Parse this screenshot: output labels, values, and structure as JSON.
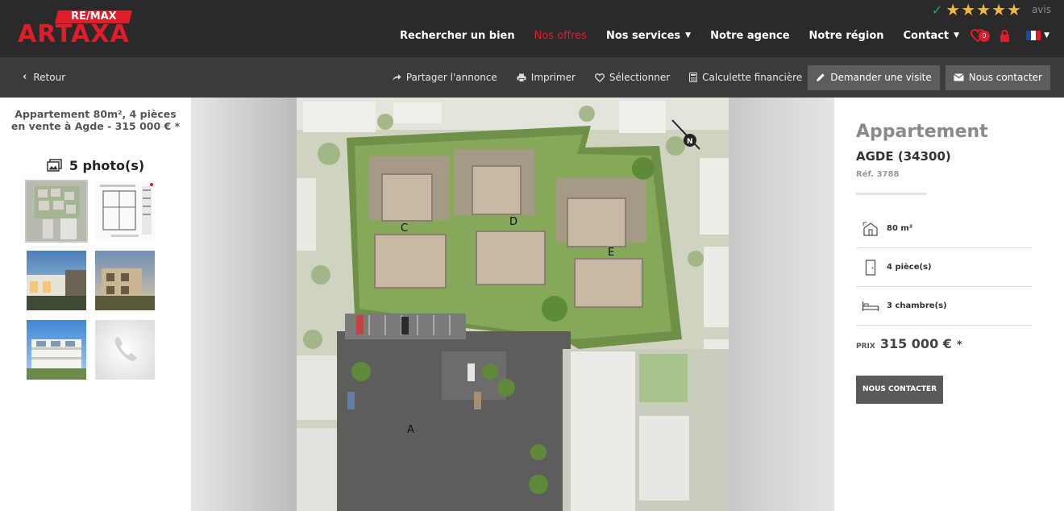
{
  "header": {
    "logo_top": "RE/MAX",
    "logo_brand": "ARTAXA",
    "rating_stars": "★★★★★",
    "rating_label": "avis",
    "nav": [
      {
        "label": "Rechercher un bien"
      },
      {
        "label": "Nos offres",
        "active": true
      },
      {
        "label": "Nos services"
      },
      {
        "label": "Notre agence"
      },
      {
        "label": "Notre région"
      },
      {
        "label": "Contact"
      }
    ],
    "favorites_count": "0"
  },
  "subbar": {
    "back_label": "Retour",
    "actions": {
      "share": "Partager l'annonce",
      "print": "Imprimer",
      "select": "Sélectionner",
      "calc": "Calculette financière",
      "visit": "Demander une visite",
      "contact": "Nous contacter"
    }
  },
  "left": {
    "title": "Appartement 80m², 4 pièces en vente à Agde - 315 000 € *",
    "photo_count": "5 photo(s)"
  },
  "property": {
    "type": "Appartement",
    "city": "AGDE (34300)",
    "ref": "Réf. 3788",
    "features": {
      "surface": "80 m²",
      "rooms": "4 pièce(s)",
      "bedrooms": "3 chambre(s)"
    },
    "price_label": "PRIX",
    "price": "315 000 €",
    "price_star": "*",
    "contact_button": "NOUS CONTACTER"
  },
  "plan": {
    "labels": {
      "a": "A",
      "c": "C",
      "d": "D",
      "e": "E"
    },
    "compass": "N"
  },
  "colors": {
    "brand_red": "#e11d2a",
    "header_bg": "#2a2a2a",
    "subbar_bg": "#3b3b3b",
    "star": "#f0b840",
    "check": "#18b26b"
  }
}
